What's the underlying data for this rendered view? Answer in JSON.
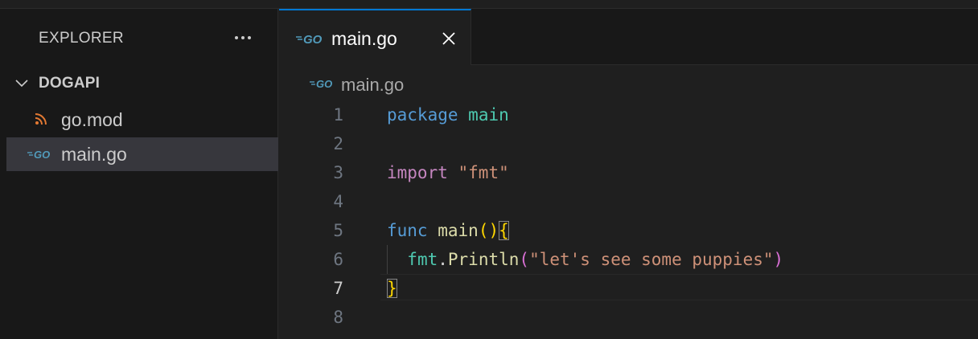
{
  "sidebar": {
    "title": "EXPLORER",
    "more_icon": "ellipsis-icon",
    "folder": {
      "name": "DOGAPI",
      "expanded": true
    },
    "files": [
      {
        "name": "go.mod",
        "icon": "rss-icon",
        "icon_color": "#e37933",
        "selected": false
      },
      {
        "name": "main.go",
        "icon": "go-icon",
        "icon_color": "#519aba",
        "selected": true
      }
    ]
  },
  "editor": {
    "tab": {
      "label": "main.go",
      "icon": "go-icon",
      "close_icon": "close-icon"
    },
    "breadcrumb": {
      "label": "main.go",
      "icon": "go-icon"
    },
    "active_line": 7,
    "lines": [
      {
        "number": "1",
        "tokens": [
          {
            "text": "package",
            "kind": "kw-blue"
          },
          {
            "text": " ",
            "kind": "plain"
          },
          {
            "text": "main",
            "kind": "pkg"
          }
        ]
      },
      {
        "number": "2",
        "tokens": []
      },
      {
        "number": "3",
        "tokens": [
          {
            "text": "import",
            "kind": "kw-pink"
          },
          {
            "text": " ",
            "kind": "plain"
          },
          {
            "text": "\"fmt\"",
            "kind": "str"
          }
        ]
      },
      {
        "number": "4",
        "tokens": []
      },
      {
        "number": "5",
        "tokens": [
          {
            "text": "func",
            "kind": "kw-blue"
          },
          {
            "text": " ",
            "kind": "plain"
          },
          {
            "text": "main",
            "kind": "fn"
          },
          {
            "text": "()",
            "kind": "brace"
          },
          {
            "text": "{",
            "kind": "brace brace-box"
          }
        ]
      },
      {
        "number": "6",
        "tokens": [
          {
            "text": "  ",
            "kind": "plain"
          },
          {
            "text": "fmt",
            "kind": "pkg"
          },
          {
            "text": ".",
            "kind": "plain"
          },
          {
            "text": "Println",
            "kind": "fn"
          },
          {
            "text": "(",
            "kind": "paren"
          },
          {
            "text": "\"let's see some puppies\"",
            "kind": "str"
          },
          {
            "text": ")",
            "kind": "paren"
          }
        ]
      },
      {
        "number": "7",
        "tokens": [
          {
            "text": "}",
            "kind": "brace brace-box"
          }
        ]
      },
      {
        "number": "8",
        "tokens": []
      }
    ]
  },
  "colors": {
    "accent": "#0078d4",
    "editor_bg": "#1f1f1f",
    "sidebar_bg": "#181818",
    "selection_bg": "#37373d"
  }
}
